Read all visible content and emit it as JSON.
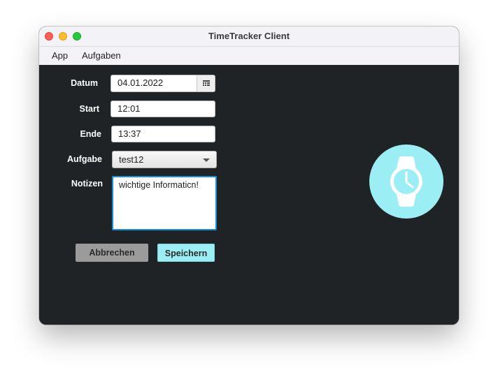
{
  "window": {
    "title": "TimeTracker Client"
  },
  "menu": {
    "items": [
      {
        "label": "App"
      },
      {
        "label": "Aufgaben"
      }
    ]
  },
  "form": {
    "date": {
      "label": "Datum",
      "value": "04.01.2022",
      "button_icon": "calendar-icon"
    },
    "start": {
      "label": "Start",
      "value": "12:01"
    },
    "end": {
      "label": "Ende",
      "value": "13:37"
    },
    "task": {
      "label": "Aufgabe",
      "selected": "test12"
    },
    "notes": {
      "label": "Notizen",
      "value": "wichtige Informaticn!"
    }
  },
  "buttons": {
    "cancel_label": "Abbrechen",
    "save_label": "Speichern"
  },
  "decoration": {
    "icon": "watch-icon",
    "badge_color": "#9beef4"
  },
  "colors": {
    "background": "#202325",
    "accent": "#9beef4",
    "focus_border": "#1a8fd6"
  }
}
